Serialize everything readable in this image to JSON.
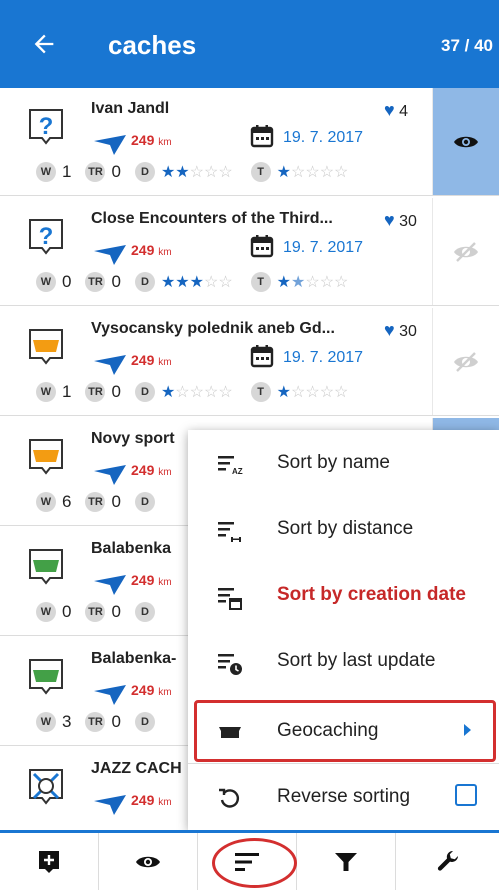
{
  "header": {
    "title": "caches",
    "count": "37 / 40",
    "color": "#1976d2"
  },
  "caches": [
    {
      "name": "Ivan Jandl",
      "fav": "4",
      "dist": "249",
      "unit": "km",
      "date": "19. 7. 2017",
      "w": "1",
      "tr": "0",
      "d_stars": 2,
      "t_stars": 1,
      "visible": true,
      "icon": "mystery-cache-icon"
    },
    {
      "name": "Close Encounters of the Third...",
      "fav": "30",
      "dist": "249",
      "unit": "km",
      "date": "19. 7. 2017",
      "w": "0",
      "tr": "0",
      "d_stars": 3,
      "t_stars": 1.5,
      "visible": false,
      "icon": "mystery-cache-icon"
    },
    {
      "name": "Vysocansky polednik aneb Gd...",
      "fav": "30",
      "dist": "249",
      "unit": "km",
      "date": "19. 7. 2017",
      "w": "1",
      "tr": "0",
      "d_stars": 1,
      "t_stars": 1,
      "visible": false,
      "icon": "multi-cache-icon"
    },
    {
      "name": "Novy sport",
      "fav": "",
      "dist": "249",
      "unit": "km",
      "date": "",
      "w": "6",
      "tr": "0",
      "d_stars": 0,
      "t_stars": 0,
      "visible": true,
      "icon": "multi-cache-icon"
    },
    {
      "name": "Balabenka",
      "fav": "",
      "dist": "249",
      "unit": "km",
      "date": "",
      "w": "0",
      "tr": "0",
      "d_stars": 0,
      "t_stars": 0,
      "visible": false,
      "icon": "traditional-cache-icon"
    },
    {
      "name": "Balabenka-",
      "fav": "",
      "dist": "249",
      "unit": "km",
      "date": "",
      "w": "3",
      "tr": "0",
      "d_stars": 0,
      "t_stars": 0,
      "visible": false,
      "icon": "traditional-cache-icon"
    },
    {
      "name": "JAZZ CACH",
      "fav": "",
      "dist": "249",
      "unit": "km",
      "date": "",
      "w": "",
      "tr": "",
      "d_stars": 0,
      "t_stars": 0,
      "visible": false,
      "icon": "unknown-cache-icon"
    }
  ],
  "badges": {
    "w": "W",
    "tr": "TR",
    "d": "D",
    "t": "T"
  },
  "menu": {
    "items": [
      {
        "label": "Sort by name",
        "icon": "sort-az-icon",
        "current": false
      },
      {
        "label": "Sort by distance",
        "icon": "sort-distance-icon",
        "current": false
      },
      {
        "label": "Sort by creation date",
        "icon": "sort-date-icon",
        "current": true
      },
      {
        "label": "Sort by last update",
        "icon": "sort-update-icon",
        "current": false
      },
      {
        "label": "Geocaching",
        "icon": "geocaching-icon",
        "current": false
      },
      {
        "label": "Reverse sorting",
        "icon": "reverse-icon",
        "current": false
      }
    ]
  },
  "bottombar": [
    "add-waypoint-icon",
    "visibility-icon",
    "sort-icon",
    "filter-icon",
    "tools-icon"
  ],
  "colors": {
    "accent": "#1976d2",
    "red": "#d32f2f",
    "star": "#1565c0"
  }
}
